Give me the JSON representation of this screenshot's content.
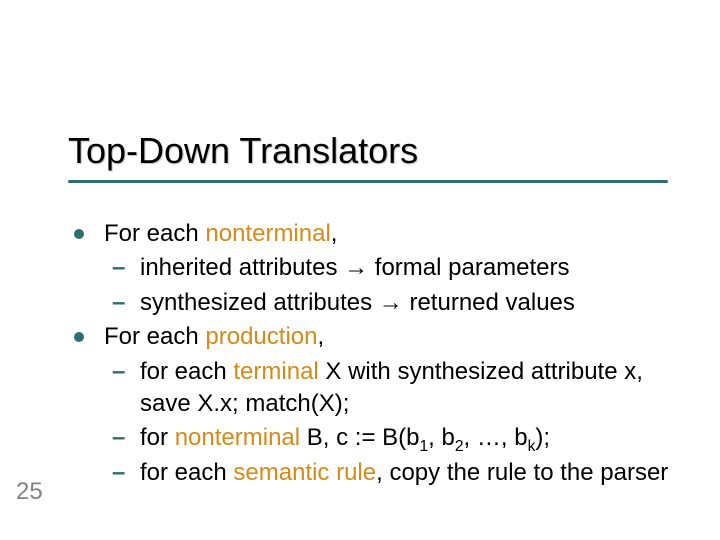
{
  "title": "Top-Down Translators",
  "page_number": "25",
  "bullets": {
    "b1": {
      "prefix": "For each ",
      "term": "nonterminal",
      "suffix": ","
    },
    "b1a": {
      "prefix": "inherited attributes ",
      "arrow": "→",
      "suffix": " formal parameters"
    },
    "b1b": {
      "prefix": "synthesized attributes ",
      "arrow": "→",
      "suffix": " returned values"
    },
    "b2": {
      "prefix": "For each ",
      "term": "production",
      "suffix": ","
    },
    "b2a": {
      "prefix": "for each ",
      "term": "terminal",
      "mid": " X with synthesized attribute x, save X.x;  match(X);"
    },
    "b2b": {
      "prefix": "for ",
      "term": "nonterminal",
      "mid": " B, c := B(b",
      "sub1": "1",
      "sep1": ", b",
      "sub2": "2",
      "sep2": ", …, b",
      "sub3": "k",
      "tail": ");"
    },
    "b2c": {
      "prefix": "for each ",
      "term": "semantic rule",
      "mid": ", copy the rule to the parser"
    }
  },
  "dash": "–"
}
